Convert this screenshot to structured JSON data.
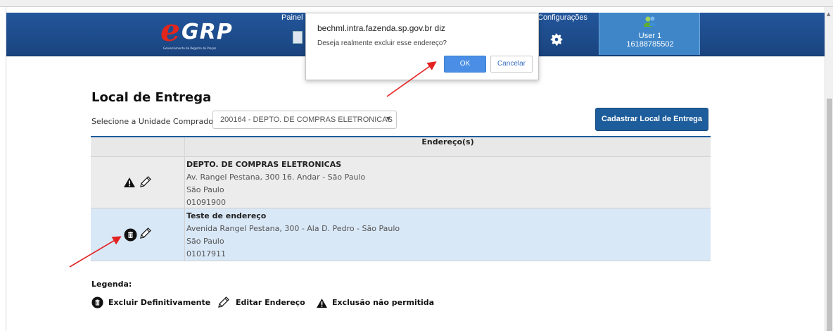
{
  "header": {
    "logo_e": "e",
    "logo_grp": "GRP",
    "logo_subtitle": "Gerenciamento de Registro de Preços",
    "nav_painel": "Painel de Controle",
    "nav_configuracoes": "Configurações",
    "user_name": "User 1",
    "user_id": "16188785502"
  },
  "page": {
    "title": "Local de Entrega",
    "select_label": "Selecione a Unidade Compradora:",
    "select_value": "200164 - DEPTO. DE COMPRAS ELETRONICAS",
    "cadastrar_button": "Cadastrar Local de Entrega"
  },
  "table": {
    "header": "Endereço(s)",
    "rows": [
      {
        "name": "DEPTO. DE COMPRAS ELETRONICAS",
        "address": "Av. Rangel Pestana, 300 16. Andar - São Paulo",
        "city": "São Paulo",
        "cep": "01091900",
        "actions": [
          "warning-icon",
          "pencil-icon"
        ]
      },
      {
        "name": "Teste de endereço",
        "address": "Avenida Rangel Pestana, 300 - Ala D. Pedro - São Paulo",
        "city": "São Paulo",
        "cep": "01017911",
        "actions": [
          "trash-icon",
          "pencil-icon"
        ]
      }
    ]
  },
  "legend": {
    "title": "Legenda:",
    "delete": "Excluir Definitivamente",
    "edit": "Editar Endereço",
    "not_allowed": "Exclusão não permitida"
  },
  "dialog": {
    "title": "bechml.intra.fazenda.sp.gov.br diz",
    "message": "Deseja realmente excluir esse endereço?",
    "ok": "OK",
    "cancel": "Cancelar"
  },
  "colors": {
    "header_blue": "#1f4e8f",
    "user_box": "#3f86c9",
    "button_blue": "#1e5d9c",
    "ok_blue": "#4a8fe5",
    "row_highlight": "#d9e8f7",
    "annotation_red": "#e32222"
  }
}
